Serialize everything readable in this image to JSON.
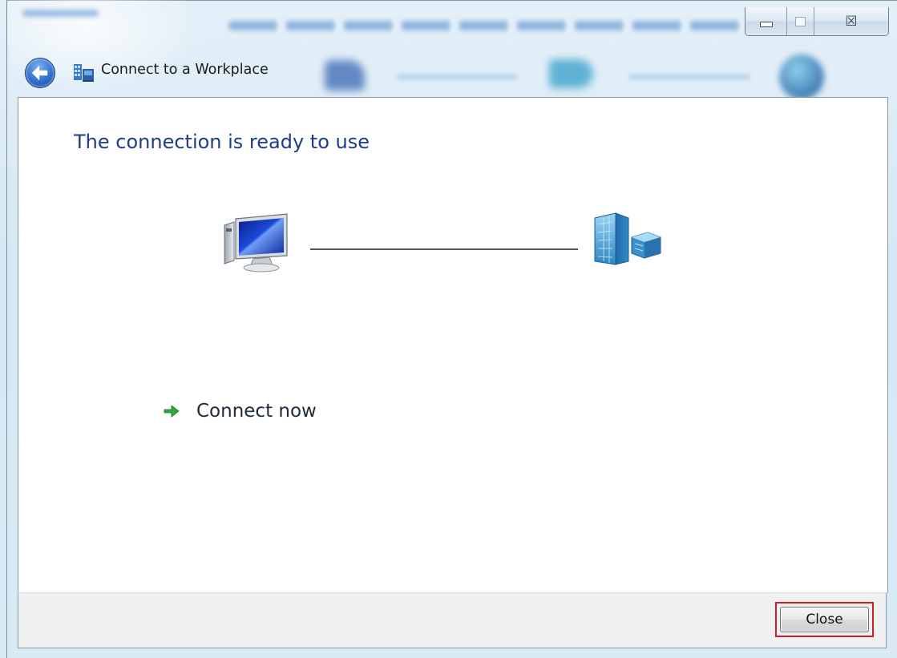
{
  "window": {
    "title": "Connect to a Workplace",
    "caption_buttons": {
      "minimize_icon": "minimize-icon",
      "maximize_icon": "maximize-icon",
      "close_icon": "close-icon",
      "close_glyph": "☒"
    }
  },
  "main": {
    "heading": "The connection is ready to use",
    "diagram": {
      "left_icon": "computer-monitor-icon",
      "right_icon": "workplace-server-icon"
    },
    "connect_link": {
      "label": "Connect now",
      "icon": "green-arrow-icon"
    }
  },
  "footer": {
    "close_label": "Close"
  },
  "colors": {
    "heading": "#1f3c8a",
    "highlight": "#c8202a"
  }
}
